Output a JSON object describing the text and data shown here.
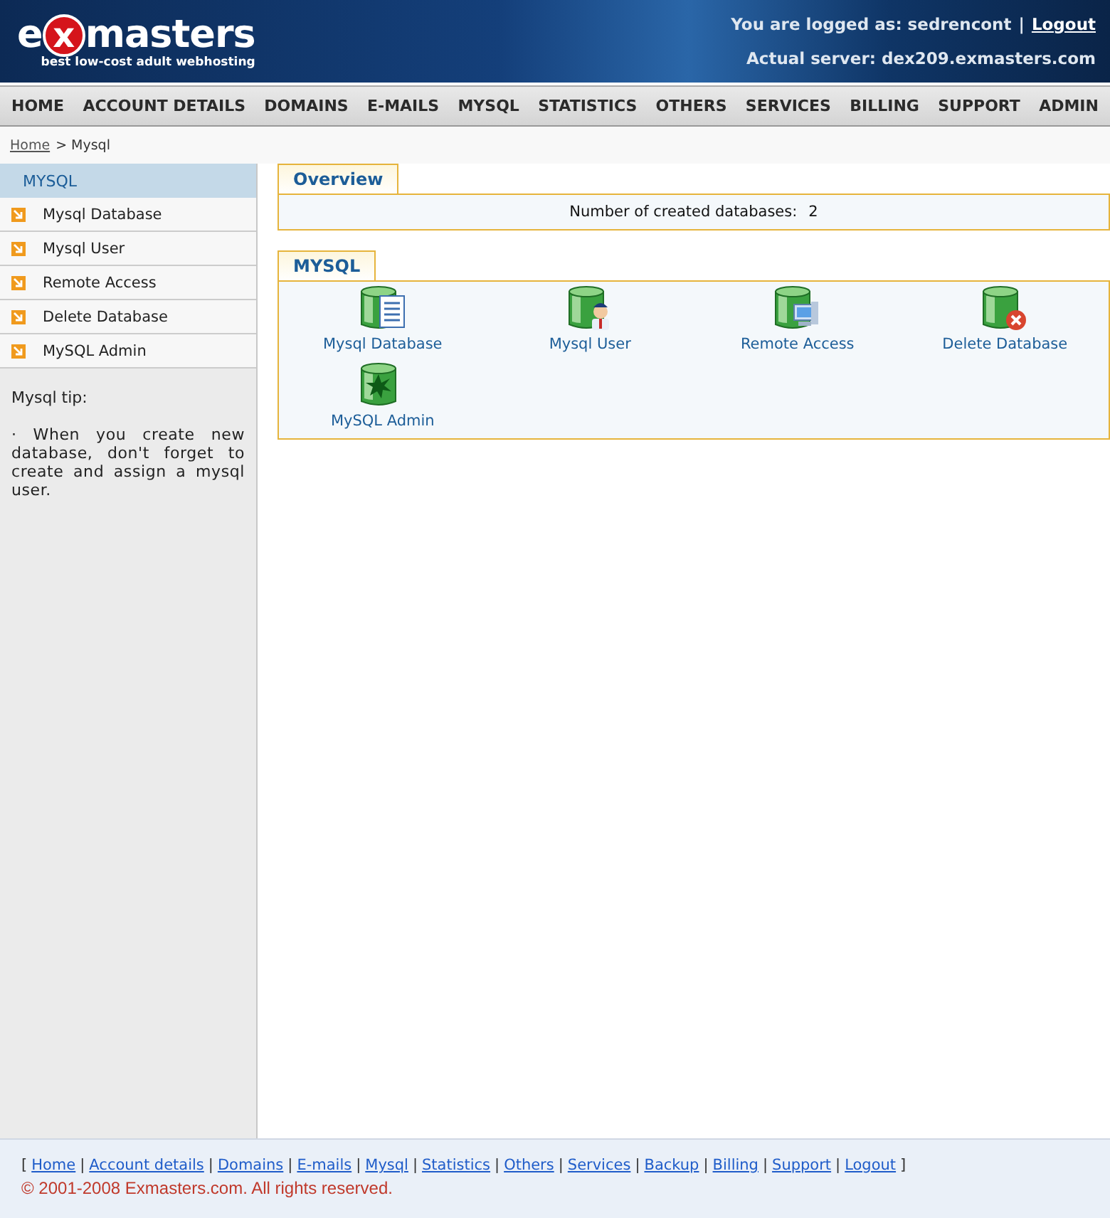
{
  "header": {
    "logo": {
      "before": "e",
      "mark": "x",
      "after": "masters",
      "tagline": "best low-cost adult webhosting"
    },
    "login_label": "You are logged as: sedrencont",
    "login_separator": "|",
    "logout": "Logout",
    "server": "Actual server: dex209.exmasters.com"
  },
  "nav": [
    "HOME",
    "ACCOUNT DETAILS",
    "DOMAINS",
    "E-MAILS",
    "MYSQL",
    "STATISTICS",
    "OTHERS",
    "SERVICES",
    "BILLING",
    "SUPPORT",
    "ADMIN"
  ],
  "breadcrumb": {
    "link": "Home",
    "rest": "> Mysql"
  },
  "sidebar": {
    "title": "MYSQL",
    "items": [
      "Mysql Database",
      "Mysql User",
      "Remote Access",
      "Delete Database",
      "MySQL Admin"
    ],
    "tip_title": "Mysql tip:",
    "tip": "· When you create new database, don't forget to create and assign a mysql user."
  },
  "overview": {
    "tab": "Overview",
    "label": "Number of created databases:",
    "value": "2"
  },
  "mysql": {
    "tab": "MYSQL",
    "tools": [
      {
        "label": "Mysql Database",
        "kind": "document"
      },
      {
        "label": "Mysql User",
        "kind": "user"
      },
      {
        "label": "Remote Access",
        "kind": "computer"
      },
      {
        "label": "Delete Database",
        "kind": "delete"
      },
      {
        "label": "MySQL Admin",
        "kind": "star"
      }
    ]
  },
  "footer": {
    "open": "[",
    "close": "]",
    "separator": "|",
    "links": [
      "Home",
      "Account details",
      "Domains",
      "E-mails",
      "Mysql",
      "Statistics",
      "Others",
      "Services",
      "Backup",
      "Billing",
      "Support",
      "Logout"
    ],
    "copyright": "© 2001-2008 Exmasters.com. All rights reserved."
  }
}
